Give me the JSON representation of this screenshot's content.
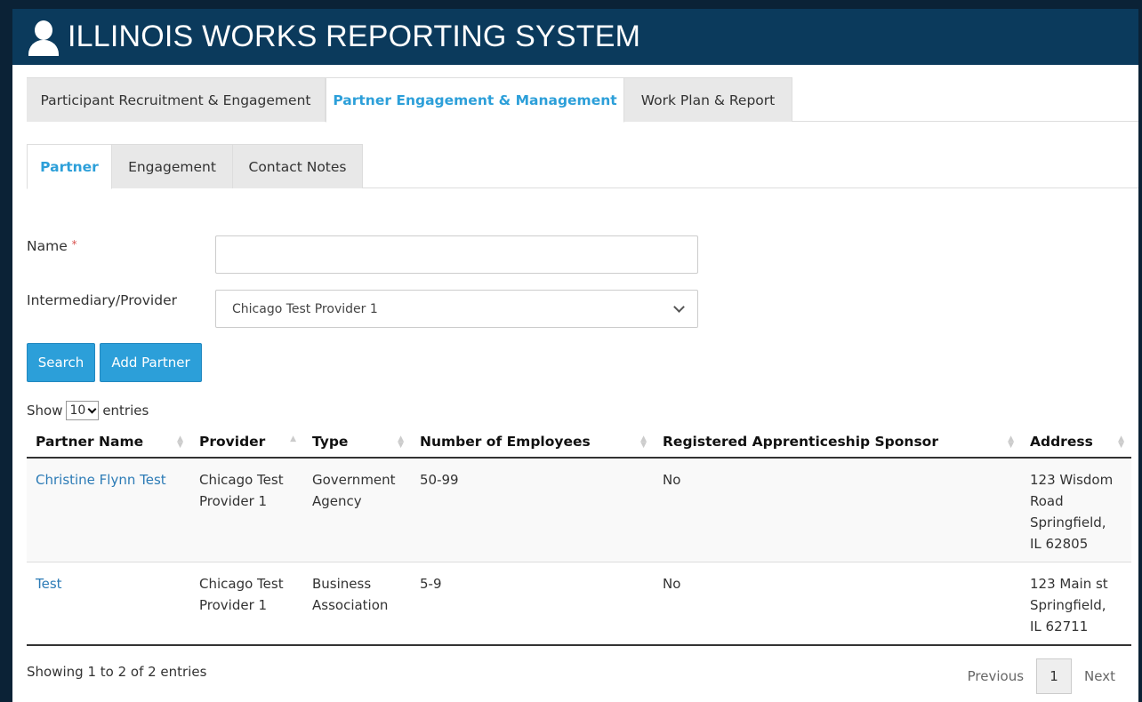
{
  "banner": {
    "title": "ILLINOIS WORKS REPORTING SYSTEM",
    "icon": "user-icon"
  },
  "main_tabs": [
    {
      "label": "Participant Recruitment & Engagement",
      "active": false
    },
    {
      "label": "Partner Engagement & Management",
      "active": true
    },
    {
      "label": "Work Plan & Report",
      "active": false
    }
  ],
  "sub_tabs": [
    {
      "label": "Partner",
      "active": true
    },
    {
      "label": "Engagement",
      "active": false
    },
    {
      "label": "Contact Notes",
      "active": false
    }
  ],
  "form": {
    "name_label": "Name",
    "required_mark": "*",
    "name_value": "",
    "provider_label": "Intermediary/Provider",
    "provider_value": "Chicago Test Provider 1"
  },
  "buttons": {
    "search": "Search",
    "add_partner": "Add Partner"
  },
  "length": {
    "show": "Show",
    "value": "10",
    "entries": "entries"
  },
  "table": {
    "columns": [
      "Partner Name",
      "Provider",
      "Type",
      "Number of Employees",
      "Registered Apprenticeship Sponsor",
      "Address"
    ],
    "sorted_column": "Provider",
    "rows": [
      {
        "partner_name": "Christine Flynn Test",
        "provider": [
          "Chicago Test",
          "Provider 1"
        ],
        "type": [
          "Government",
          "Agency"
        ],
        "employees": "50-99",
        "sponsor": "No",
        "address": [
          "123 Wisdom",
          "Road",
          "Springfield,",
          "IL 62805"
        ]
      },
      {
        "partner_name": "Test",
        "provider": [
          "Chicago Test",
          "Provider 1"
        ],
        "type": [
          "Business",
          "Association"
        ],
        "employees": "5-9",
        "sponsor": "No",
        "address": [
          "123 Main st",
          "Springfield,",
          "IL 62711"
        ]
      }
    ]
  },
  "footer": {
    "info": "Showing 1 to 2 of 2 entries",
    "previous": "Previous",
    "page": "1",
    "next": "Next"
  },
  "colors": {
    "banner": "#0b3a5c",
    "accent": "#2c9fd9",
    "link": "#2c7bb6"
  }
}
